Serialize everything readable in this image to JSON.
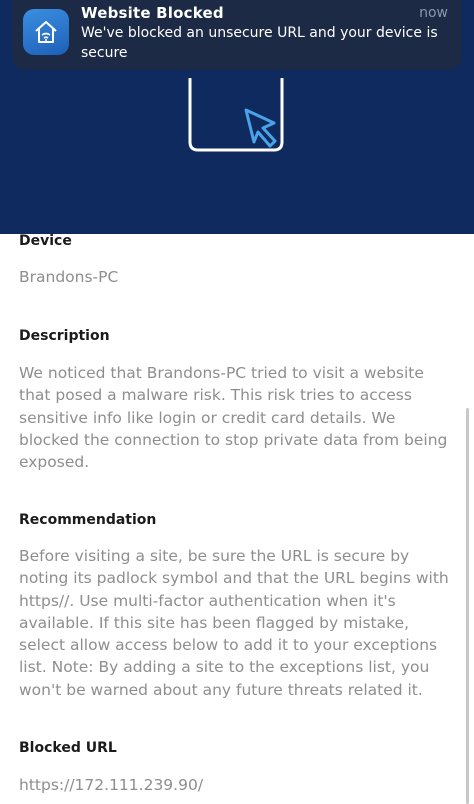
{
  "notification": {
    "icon": "home-wifi-icon",
    "title": "Website Blocked",
    "time": "now",
    "body": "We've blocked an unsecure URL and your device is secure"
  },
  "hero": {
    "illustration": "browser-window-cursor-icon",
    "background_color": "#0f2a5e"
  },
  "details": {
    "device_label": "Device",
    "device_value": "Brandons-PC",
    "description_label": "Description",
    "description_text": "We noticed that Brandons-PC tried to visit a website that posed a malware risk. This risk tries to access sensitive info like login or credit card details. We blocked the connection to stop private data from being exposed.",
    "recommendation_label": "Recommendation",
    "recommendation_text": "Before visiting a site, be sure the URL is secure by noting its padlock symbol and that the URL begins with https//. Use multi-factor authentication when it's available. If this site has been flagged by mistake, select allow access below to add it to your exceptions list. Note: By adding a site to the exceptions list, you won't be warned about any future threats related it.",
    "blocked_url_label": "Blocked URL",
    "blocked_url_value": "https://172.111.239.90/"
  }
}
